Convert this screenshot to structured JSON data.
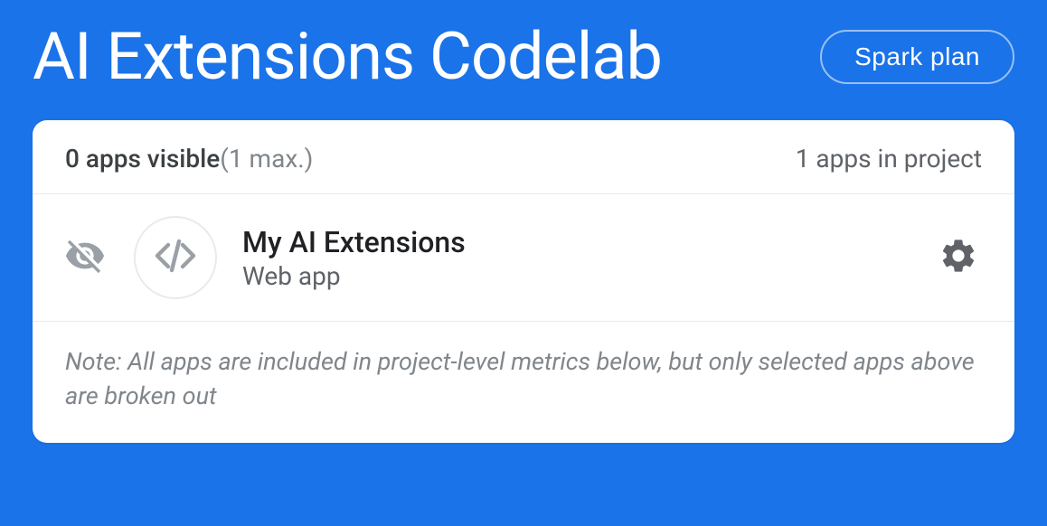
{
  "header": {
    "title": "AI Extensions Codelab",
    "plan_label": "Spark plan"
  },
  "card": {
    "visible_count": "0 apps visible",
    "max_text": "(1 max.)",
    "project_count": "1 apps in project",
    "app": {
      "name": "My AI Extensions",
      "type": "Web app"
    },
    "note": "Note: All apps are included in project-level metrics below, but only selected apps above are broken out"
  },
  "colors": {
    "background": "#1a73e8",
    "card_bg": "#ffffff",
    "text_primary": "#202124",
    "text_secondary": "#5f6368",
    "text_muted": "#80868b",
    "border": "#e8eaed"
  }
}
